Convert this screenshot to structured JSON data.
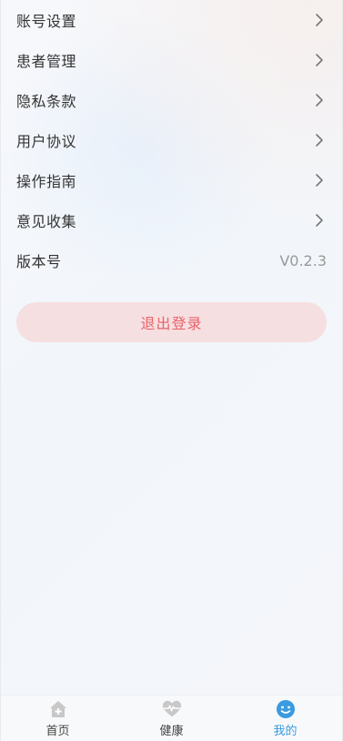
{
  "menu": {
    "items": [
      {
        "label": "账号设置",
        "icon": "chevron-right-icon"
      },
      {
        "label": "患者管理",
        "icon": "chevron-right-icon"
      },
      {
        "label": "隐私条款",
        "icon": "chevron-right-icon"
      },
      {
        "label": "用户协议",
        "icon": "chevron-right-icon"
      },
      {
        "label": "操作指南",
        "icon": "chevron-right-icon"
      },
      {
        "label": "意见收集",
        "icon": "chevron-right-icon"
      }
    ],
    "version": {
      "label": "版本号",
      "value": "V0.2.3"
    }
  },
  "logout": {
    "label": "退出登录"
  },
  "tabbar": {
    "tabs": [
      {
        "label": "首页",
        "icon": "home-icon",
        "active": false
      },
      {
        "label": "健康",
        "icon": "heartbeat-icon",
        "active": false
      },
      {
        "label": "我的",
        "icon": "smiley-face-icon",
        "active": true
      }
    ]
  },
  "colors": {
    "accent": "#3a9be0",
    "logout_bg": "#f6dfe1",
    "logout_text": "#e8636a",
    "muted_text": "#999999",
    "icon_gray": "#c8c8c8"
  }
}
